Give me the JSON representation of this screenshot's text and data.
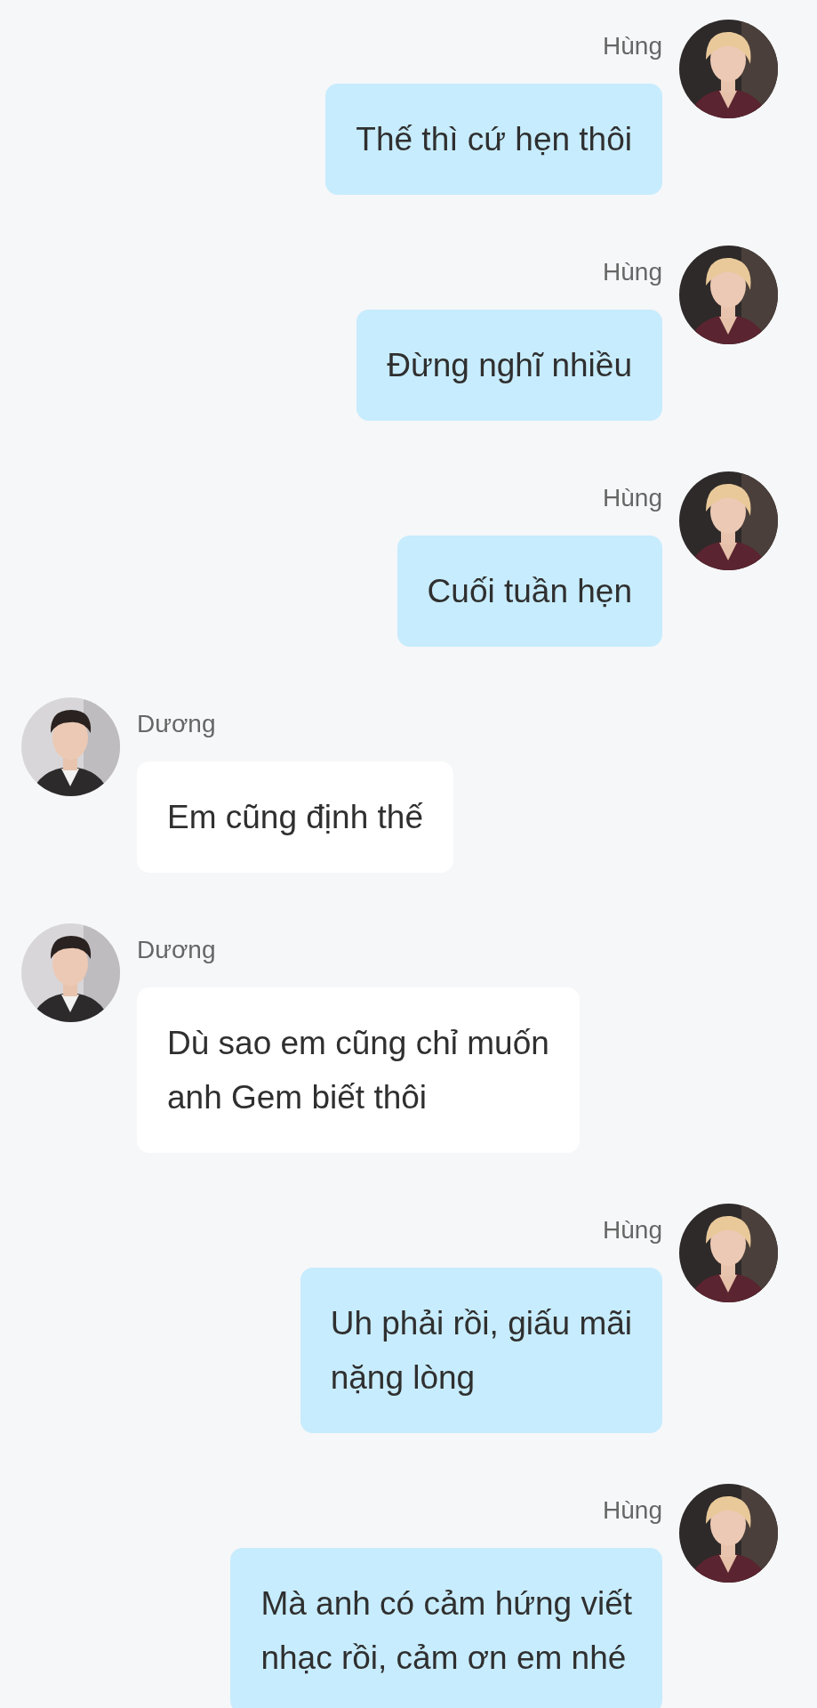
{
  "messages": [
    {
      "sender": "Hùng",
      "outgoing": true,
      "text": "Thế thì cứ hẹn thôi"
    },
    {
      "sender": "Hùng",
      "outgoing": true,
      "text": "Đừng nghĩ nhiều"
    },
    {
      "sender": "Hùng",
      "outgoing": true,
      "text": "Cuối tuần hẹn"
    },
    {
      "sender": "Dương",
      "outgoing": false,
      "text": "Em cũng định thế"
    },
    {
      "sender": "Dương",
      "outgoing": false,
      "text": "Dù sao em cũng chỉ muốn\nanh Gem biết thôi"
    },
    {
      "sender": "Hùng",
      "outgoing": true,
      "text": "Uh phải rồi, giấu mãi\nnặng lòng"
    },
    {
      "sender": "Hùng",
      "outgoing": true,
      "text": "Mà anh có cảm hứng viết\nnhạc rồi, cảm ơn em nhé"
    }
  ]
}
